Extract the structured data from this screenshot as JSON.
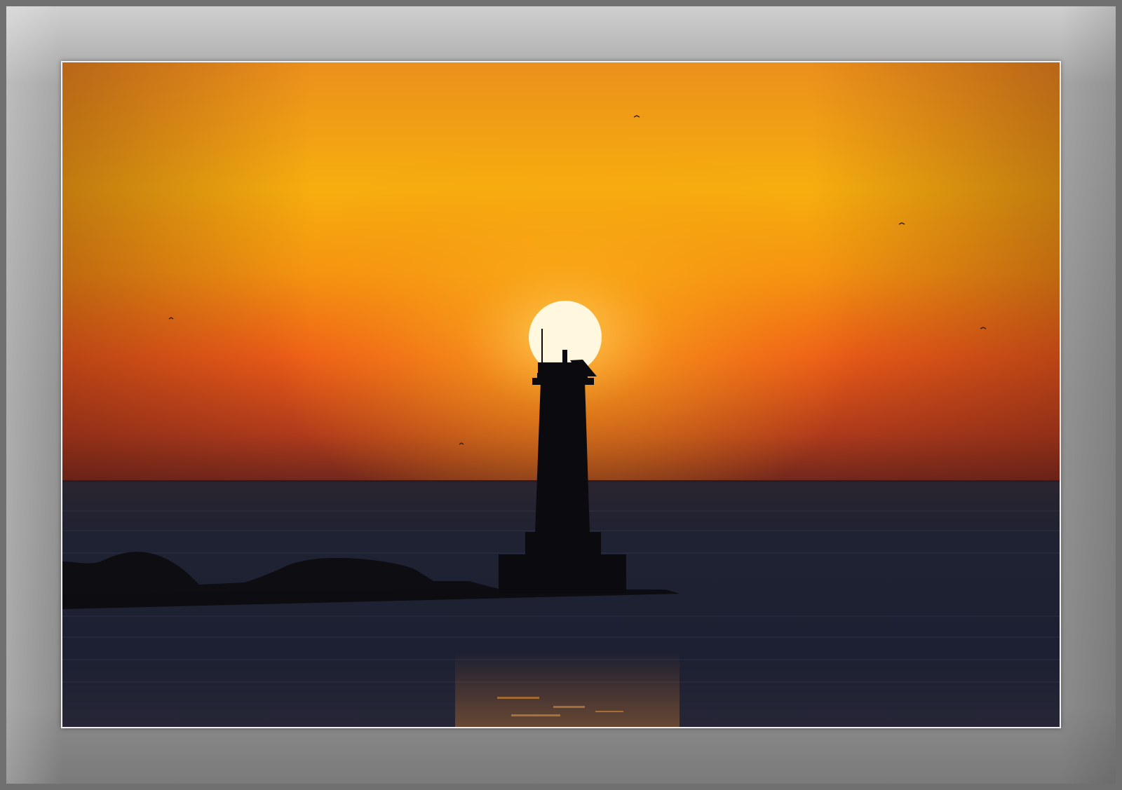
{
  "photo": {
    "subject": "lighthouse-sunset",
    "colors": {
      "sky_top": "#f0a020",
      "sky_mid": "#f5b010",
      "sky_glow": "#f07018",
      "sky_horizon": "#7a2a1e",
      "sun": "#fff6d8",
      "sea": "#1c2030",
      "silhouette": "#0c0c10",
      "frame": "#939393"
    }
  }
}
